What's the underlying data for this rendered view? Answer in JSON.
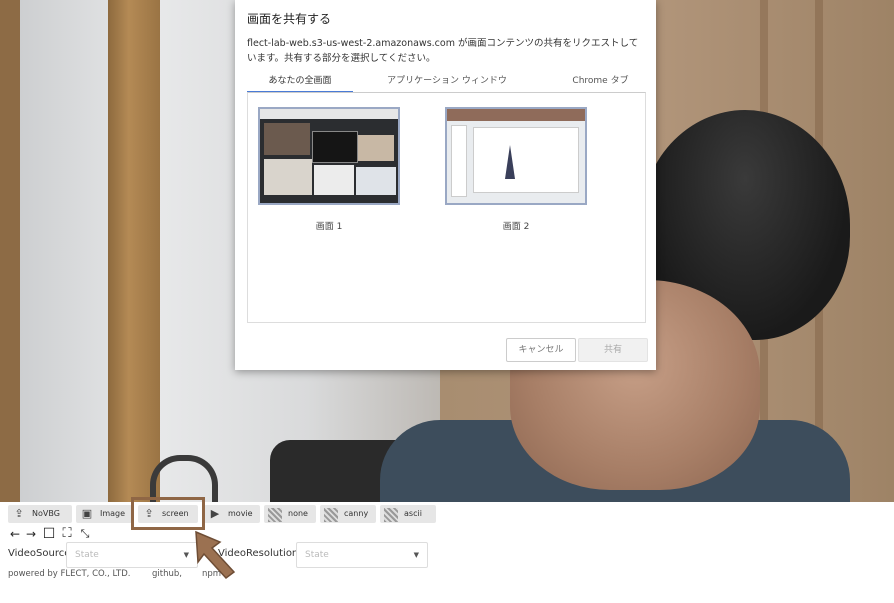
{
  "dialog": {
    "title": "画面を共有する",
    "description": "flect-lab-web.s3-us-west-2.amazonaws.com が画面コンテンツの共有をリクエストしています。共有する部分を選択してください。",
    "tabs": [
      {
        "label": "あなたの全画面",
        "active": true
      },
      {
        "label": "アプリケーション ウィンドウ",
        "active": false
      },
      {
        "label": "Chrome タブ",
        "active": false
      }
    ],
    "screens": [
      {
        "label": "画面 1"
      },
      {
        "label": "画面 2"
      }
    ],
    "cancel_label": "キャンセル",
    "share_label": "共有"
  },
  "toolbar": {
    "buttons": [
      {
        "label": "NoVBG",
        "icon": "share-screen-icon"
      },
      {
        "label": "Image",
        "icon": "image-icon"
      },
      {
        "label": "screen",
        "icon": "share-screen-icon"
      },
      {
        "label": "movie",
        "icon": "play-icon"
      },
      {
        "label": "none",
        "icon": "checker-icon"
      },
      {
        "label": "canny",
        "icon": "checker-icon"
      },
      {
        "label": "ascii",
        "icon": "checker-icon"
      }
    ]
  },
  "nav_icons": [
    "arrow-left-icon",
    "arrow-right-icon",
    "square-icon",
    "fullscreen-icon",
    "exit-fullscreen-icon"
  ],
  "video_source": {
    "label": "VideoSource",
    "value": "State"
  },
  "video_resolution": {
    "label": "VideoResolution",
    "value": "State"
  },
  "footer": {
    "powered": "powered by FLECT, CO., LTD.",
    "github": "github,",
    "npm": "npm"
  },
  "colors": {
    "highlight": "#8f6645",
    "tab_active": "#4a7bd6",
    "toolbar_button": "#e6e6e6"
  }
}
